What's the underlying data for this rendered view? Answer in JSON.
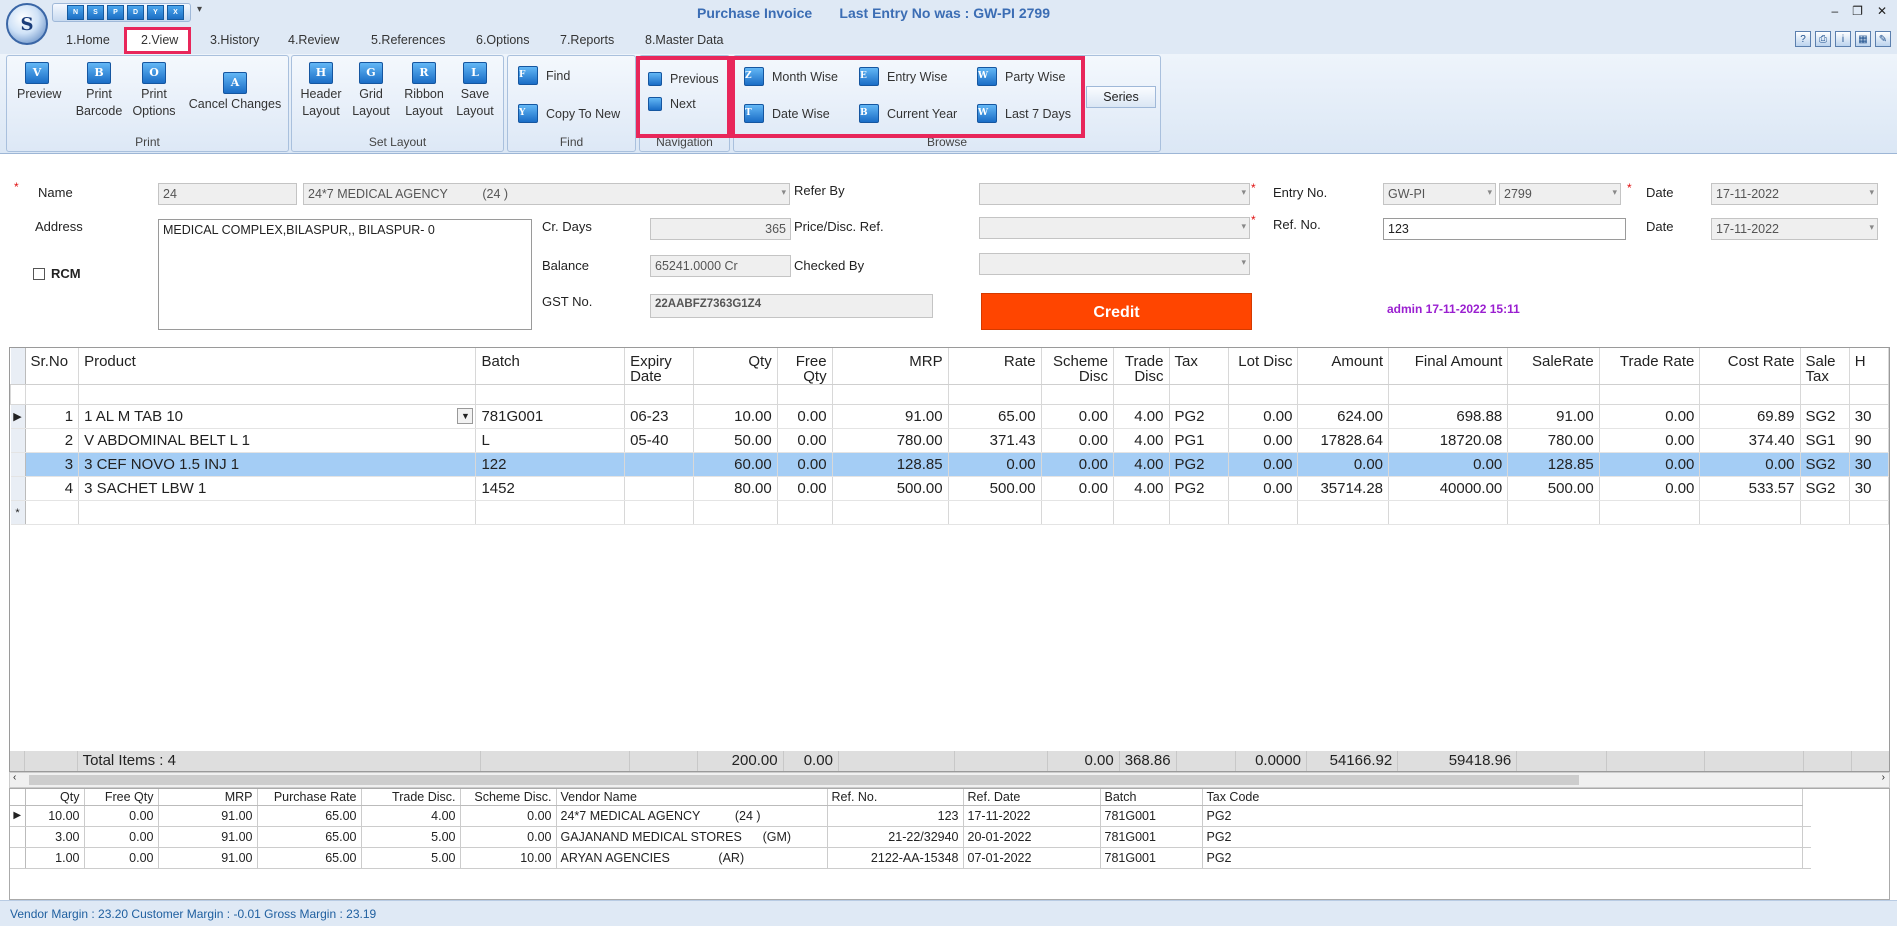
{
  "window": {
    "title": "Purchase Invoice",
    "last_entry": "Last Entry No was : GW-PI 2799",
    "logo_letter": "S",
    "qat_buttons": [
      "N",
      "S",
      "P",
      "D",
      "Y",
      "X"
    ],
    "controls": [
      "–",
      "❐",
      "✕"
    ]
  },
  "menu": {
    "tabs": [
      "1.Home",
      "2.View",
      "3.History",
      "4.Review",
      "5.References",
      "6.Options",
      "7.Reports",
      "8.Master Data"
    ]
  },
  "ribbon": {
    "print": {
      "label": "Print",
      "preview": "Preview",
      "print_barcode_1": "Print",
      "print_barcode_2": "Barcode",
      "print_options_1": "Print",
      "print_options_2": "Options",
      "cancel_changes": "Cancel Changes"
    },
    "set_layout": {
      "label": "Set Layout",
      "header_1": "Header",
      "header_2": "Layout",
      "grid_1": "Grid",
      "grid_2": "Layout",
      "ribbon_1": "Ribbon",
      "ribbon_2": "Layout",
      "save_1": "Save",
      "save_2": "Layout"
    },
    "find": {
      "label": "Find",
      "find": "Find",
      "copy_to_new": "Copy To New"
    },
    "navigation": {
      "label": "Navigation",
      "previous": "Previous",
      "next": "Next"
    },
    "browse": {
      "label": "Browse",
      "month_wise": "Month Wise",
      "entry_wise": "Entry Wise",
      "party_wise": "Party Wise",
      "date_wise": "Date Wise",
      "current_year": "Current Year",
      "last_7_days": "Last 7 Days",
      "series": "Series"
    }
  },
  "form": {
    "name_label": "Name",
    "name_code": "24",
    "name_value": "24*7 MEDICAL AGENCY          (24 )",
    "address_label": "Address",
    "address_value": "MEDICAL COMPLEX,BILASPUR,, BILASPUR- 0",
    "rcm_label": "RCM",
    "cr_days_label": "Cr. Days",
    "cr_days_value": "365",
    "balance_label": "Balance",
    "balance_value": "65241.0000 Cr",
    "gst_label": "GST No.",
    "gst_value": "22AABFZ7363G1Z4",
    "refer_by_label": "Refer By",
    "price_disc_label": "Price/Disc. Ref.",
    "checked_by_label": "Checked By",
    "entry_no_label": "Entry No.",
    "entry_series": "GW-PI",
    "entry_number": "2799",
    "ref_no_label": "Ref. No.",
    "ref_no_value": "123",
    "date_label": "Date",
    "date_value": "17-11-2022",
    "date2_label": "Date",
    "date2_value": "17-11-2022",
    "credit_label": "Credit",
    "admin_stamp": "admin 17-11-2022 15:11"
  },
  "grid": {
    "columns": [
      "Sr.No",
      "Product",
      "Batch",
      "Expiry Date",
      "Qty",
      "Free Qty",
      "MRP",
      "Rate",
      "Scheme Disc",
      "Trade Disc",
      "Tax",
      "Lot Disc",
      "Amount",
      "Final Amount",
      "SaleRate",
      "Trade Rate",
      "Cost Rate",
      "Sale Tax",
      "H"
    ],
    "rows": [
      [
        "1",
        "1 AL M TAB 10",
        "781G001",
        "06-23",
        "10.00",
        "0.00",
        "91.00",
        "65.00",
        "0.00",
        "4.00",
        "PG2",
        "0.00",
        "624.00",
        "698.88",
        "91.00",
        "0.00",
        "69.89",
        "SG2",
        "30"
      ],
      [
        "2",
        "V ABDOMINAL BELT L 1",
        "L",
        "05-40",
        "50.00",
        "0.00",
        "780.00",
        "371.43",
        "0.00",
        "4.00",
        "PG1",
        "0.00",
        "17828.64",
        "18720.08",
        "780.00",
        "0.00",
        "374.40",
        "SG1",
        "90"
      ],
      [
        "3",
        "3 CEF NOVO 1.5 INJ 1",
        "122",
        "",
        "60.00",
        "0.00",
        "128.85",
        "0.00",
        "0.00",
        "4.00",
        "PG2",
        "0.00",
        "0.00",
        "0.00",
        "128.85",
        "0.00",
        "0.00",
        "SG2",
        "30"
      ],
      [
        "4",
        "3 SACHET LBW 1",
        "1452",
        "",
        "80.00",
        "0.00",
        "500.00",
        "500.00",
        "0.00",
        "4.00",
        "PG2",
        "0.00",
        "35714.28",
        "40000.00",
        "500.00",
        "0.00",
        "533.57",
        "SG2",
        "30"
      ]
    ],
    "total_label": "Total Items : 4",
    "totals": {
      "qty": "200.00",
      "free_qty": "0.00",
      "scheme_disc": "0.00",
      "trade_disc": "368.86",
      "lot_disc": "0.0000",
      "amount": "54166.92",
      "final_amount": "59418.96"
    }
  },
  "history": {
    "columns": [
      "Qty",
      "Free Qty",
      "MRP",
      "Purchase Rate",
      "Trade Disc.",
      "Scheme Disc.",
      "Vendor Name",
      "Ref. No.",
      "Ref. Date",
      "Batch",
      "Tax Code"
    ],
    "rows": [
      [
        "10.00",
        "0.00",
        "91.00",
        "65.00",
        "4.00",
        "0.00",
        "24*7 MEDICAL AGENCY          (24 )",
        "123",
        "17-11-2022",
        "781G001",
        "PG2"
      ],
      [
        "3.00",
        "0.00",
        "91.00",
        "65.00",
        "5.00",
        "0.00",
        "GAJANAND MEDICAL STORES      (GM)",
        "21-22/32940",
        "20-01-2022",
        "781G001",
        "PG2"
      ],
      [
        "1.00",
        "0.00",
        "91.00",
        "65.00",
        "5.00",
        "10.00",
        "ARYAN AGENCIES              (AR)",
        "2122-AA-15348",
        "07-01-2022",
        "781G001",
        "PG2"
      ]
    ]
  },
  "status": {
    "text": "Vendor Margin : 23.20 Customer Margin : -0.01 Gross Margin : 23.19"
  },
  "colors": {
    "highlight": "#e8265a",
    "credit": "#ff4500",
    "selected_row": "#a4cdf5",
    "title": "#3b6db4"
  }
}
